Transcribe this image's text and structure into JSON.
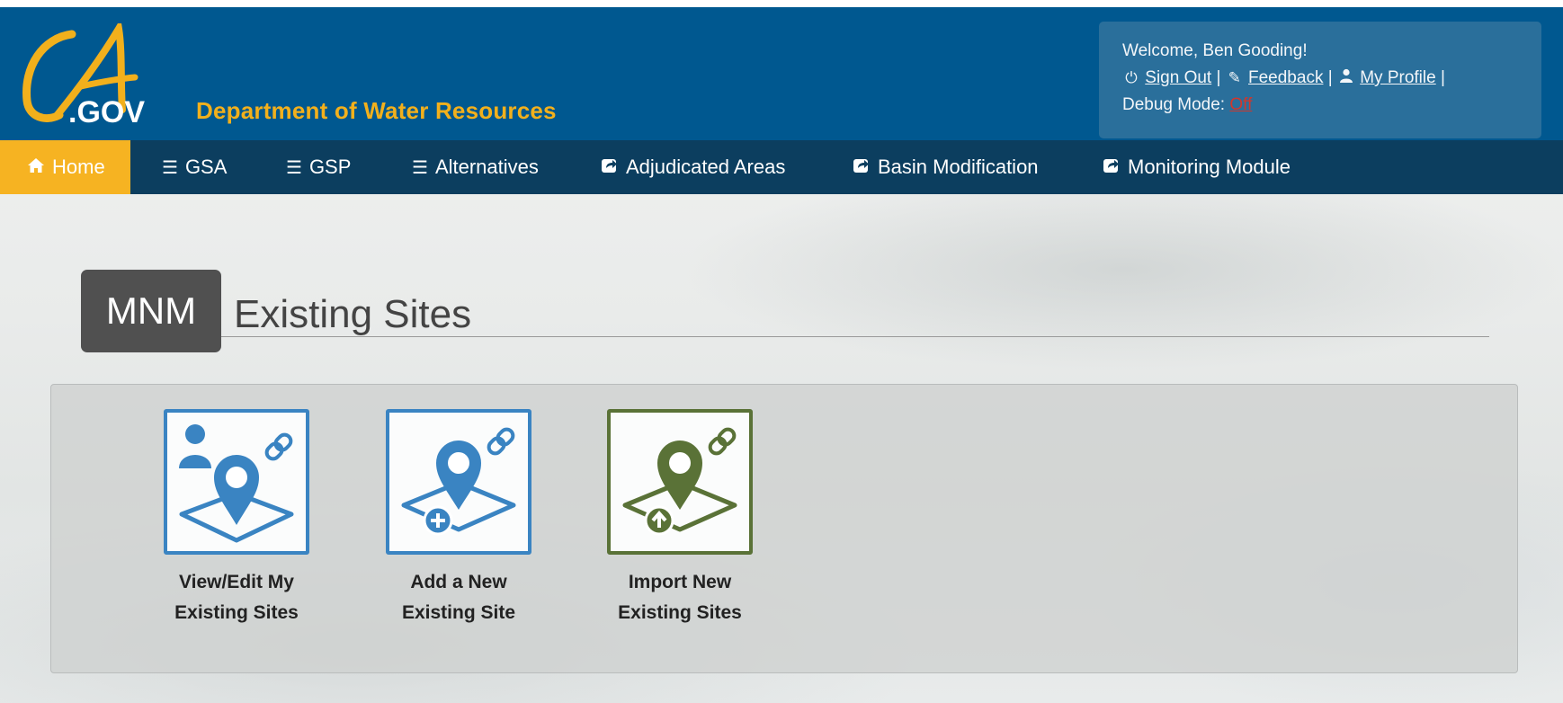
{
  "header": {
    "logo_text_ca": "CA",
    "logo_text_gov": ".GOV",
    "department": "Department of Water Resources",
    "welcome": "Welcome, Ben Gooding!",
    "sign_out": "Sign Out",
    "feedback": "Feedback",
    "my_profile": "My Profile",
    "separator": "|",
    "debug_label": "Debug Mode:",
    "debug_value": "Off"
  },
  "nav": {
    "items": [
      {
        "label": "Home",
        "icon": "home-icon"
      },
      {
        "label": "GSA",
        "icon": "menu-icon"
      },
      {
        "label": "GSP",
        "icon": "menu-icon"
      },
      {
        "label": "Alternatives",
        "icon": "menu-icon"
      },
      {
        "label": "Adjudicated Areas",
        "icon": "external-link-icon"
      },
      {
        "label": "Basin Modification",
        "icon": "external-link-icon"
      },
      {
        "label": "Monitoring Module",
        "icon": "external-link-icon"
      }
    ]
  },
  "page": {
    "badge": "MNM",
    "title": "Existing Sites"
  },
  "tiles": [
    {
      "line1": "View/Edit My",
      "line2": "Existing Sites",
      "icon": "view-edit-sites-icon"
    },
    {
      "line1": "Add a New",
      "line2": "Existing Site",
      "icon": "add-site-icon"
    },
    {
      "line1": "Import New",
      "line2": "Existing Sites",
      "icon": "import-sites-icon"
    }
  ],
  "colors": {
    "header_blue": "#005890",
    "nav_dark": "#0c3e5f",
    "accent_gold": "#f6b322",
    "tile_blue": "#3a84c2",
    "tile_green": "#5a7237",
    "debug_off_red": "#d0372c"
  }
}
